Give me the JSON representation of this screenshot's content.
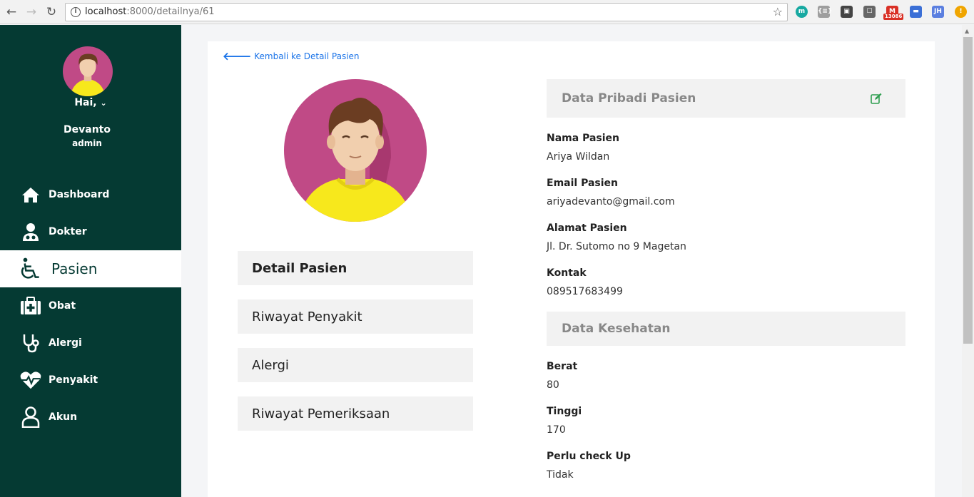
{
  "browser": {
    "url_host": "localhost",
    "url_path": ":8000/detailnya/61",
    "extensions": [
      {
        "name": "m-extension-icon",
        "label": "m",
        "color": "#17a9a1"
      },
      {
        "name": "json-extension-icon",
        "label": "{≡}",
        "color": "#9e9e9e"
      },
      {
        "name": "screenshot-extension-icon",
        "label": "▣",
        "color": "#444444"
      },
      {
        "name": "chat-extension-icon",
        "label": "☐",
        "color": "#666666"
      },
      {
        "name": "gmail-extension-icon",
        "label": "M",
        "color": "#d93025",
        "badge": "13086"
      },
      {
        "name": "window-extension-icon",
        "label": "▬",
        "color": "#3b6fd6"
      },
      {
        "name": "jh-extension-icon",
        "label": "JH",
        "color": "#5b7fe0"
      },
      {
        "name": "alert-extension-icon",
        "label": "!",
        "color": "#f0a500"
      }
    ]
  },
  "sidebar": {
    "greeting": "Hai,",
    "user_name": "Devanto",
    "user_role": "admin",
    "items": [
      {
        "label": "Dashboard",
        "icon": "home-icon"
      },
      {
        "label": "Dokter",
        "icon": "doctor-icon"
      },
      {
        "label": "Pasien",
        "icon": "wheelchair-icon",
        "active": true
      },
      {
        "label": "Obat",
        "icon": "medkit-icon"
      },
      {
        "label": "Alergi",
        "icon": "stethoscope-icon"
      },
      {
        "label": "Penyakit",
        "icon": "heartbeat-icon"
      },
      {
        "label": "Akun",
        "icon": "user-icon"
      }
    ]
  },
  "main": {
    "back_link": "Kembali ke Detail Pasien",
    "menu": [
      "Detail Pasien",
      "Riwayat Penyakit",
      "Alergi",
      "Riwayat Pemeriksaan"
    ],
    "personal": {
      "title": "Data Pribadi Pasien",
      "fields": [
        {
          "label": "Nama Pasien",
          "value": "Ariya Wildan"
        },
        {
          "label": "Email Pasien",
          "value": "ariyadevanto@gmail.com"
        },
        {
          "label": "Alamat Pasien",
          "value": "Jl. Dr. Sutomo no 9 Magetan"
        },
        {
          "label": "Kontak",
          "value": "089517683499"
        }
      ]
    },
    "health": {
      "title": "Data Kesehatan",
      "fields": [
        {
          "label": "Berat",
          "value": "80"
        },
        {
          "label": "Tinggi",
          "value": "170"
        },
        {
          "label": "Perlu check Up",
          "value": "Tidak"
        }
      ]
    }
  },
  "colors": {
    "sidebar": "#053a33",
    "accent_link": "#1a73e8",
    "edit_icon": "#2e9e4f",
    "avatar_bg": "#c04a86",
    "shirt": "#f7e81c"
  }
}
